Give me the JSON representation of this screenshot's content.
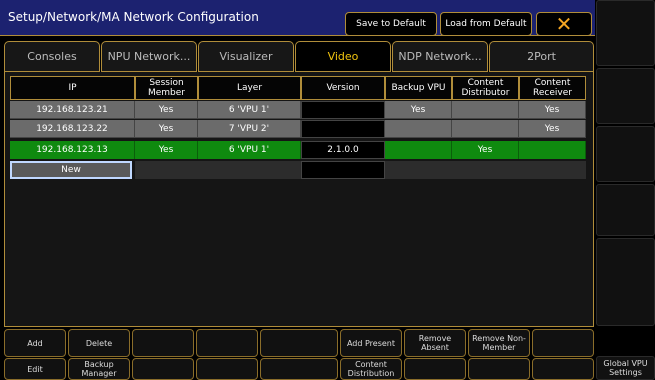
{
  "window": {
    "title": "Setup/Network/MA Network Configuration",
    "save_default": "Save to Default",
    "load_default": "Load from Default",
    "close_icon": "close-icon"
  },
  "tabs": [
    {
      "label": "Consoles",
      "active": false
    },
    {
      "label": "NPU Network...",
      "active": false
    },
    {
      "label": "Visualizer",
      "active": false
    },
    {
      "label": "Video",
      "active": true
    },
    {
      "label": "NDP Network...",
      "active": false
    },
    {
      "label": "2Port",
      "active": false
    }
  ],
  "table": {
    "headers": [
      "IP",
      "Session Member",
      "Layer",
      "Version",
      "Backup VPU",
      "Content Distributor",
      "Content Receiver"
    ],
    "rows": [
      {
        "ip": "192.168.123.21",
        "session": "Yes",
        "layer": "6 'VPU 1'",
        "version": "",
        "backup": "Yes",
        "distributor": "",
        "receiver": "Yes",
        "highlight": false
      },
      {
        "ip": "192.168.123.22",
        "session": "Yes",
        "layer": "7 'VPU 2'",
        "version": "",
        "backup": "",
        "distributor": "",
        "receiver": "Yes",
        "highlight": false
      },
      {
        "ip": "192.168.123.13",
        "session": "Yes",
        "layer": "6 'VPU 1'",
        "version": "2.1.0.0",
        "backup": "",
        "distributor": "Yes",
        "receiver": "",
        "highlight": true
      }
    ],
    "new_label": "New"
  },
  "bottom": {
    "add": "Add",
    "delete": "Delete",
    "add_present": "Add Present",
    "remove_absent": "Remove Absent",
    "remove_non_member": "Remove Non-Member",
    "edit": "Edit",
    "backup_manager": "Backup Manager",
    "content_distribution": "Content Distribution"
  },
  "sidebar": {
    "global_vpu_settings": "Global VPU Settings"
  },
  "colors": {
    "title_bar": "#1c2270",
    "accent_border": "#b08d3a",
    "active_tab_text": "#f1c40f",
    "highlight_row": "#0f8a0f",
    "gray_row": "#6b6b6b",
    "close_icon": "#f5a623"
  }
}
